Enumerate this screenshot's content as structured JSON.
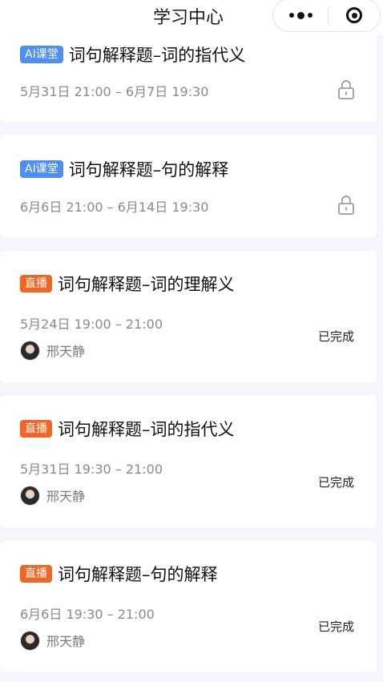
{
  "nav": {
    "title": "学习中心"
  },
  "courses": [
    {
      "tag": "AI课堂",
      "tag_type": "ai",
      "title": "词句解释题–词的指代义",
      "time": "5月31日 21:00 – 6月7日 19:30",
      "status": "locked"
    },
    {
      "tag": "AI课堂",
      "tag_type": "ai",
      "title": "词句解释题–句的解释",
      "time": "6月6日 21:00 – 6月14日 19:30",
      "status": "locked"
    },
    {
      "tag": "直播",
      "tag_type": "live",
      "title": "词句解释题–词的理解义",
      "time": "5月24日 19:00 – 21:00",
      "teacher": "邢天静",
      "status_text": "已完成"
    },
    {
      "tag": "直播",
      "tag_type": "live",
      "title": "词句解释题–词的指代义",
      "time": "5月31日 19:30 – 21:00",
      "teacher": "邢天静",
      "status_text": "已完成"
    },
    {
      "tag": "直播",
      "tag_type": "live",
      "title": "词句解释题–句的解释",
      "time": "6月6日 19:30 – 21:00",
      "teacher": "邢天静",
      "status_text": "已完成"
    }
  ],
  "colors": {
    "ai_tag": "#4e8ef7",
    "live_tag": "#f26522",
    "background": "#f4f6fb"
  },
  "icons": {
    "more": "more-dots-icon",
    "close": "target-circle-icon",
    "lock": "lock-icon",
    "avatar": "teacher-avatar"
  }
}
